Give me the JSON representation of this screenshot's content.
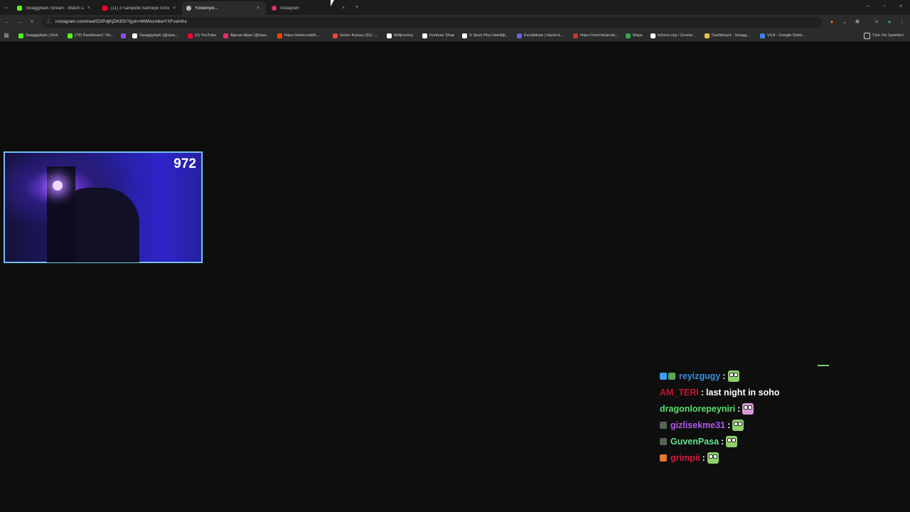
{
  "tabs": [
    {
      "title": "Swaggybark Stream - Watch Li",
      "color": "#53fc18",
      "active": false
    },
    {
      "title": "(11) 3 Saniyede Sahneye Göre",
      "color": "#ff0033",
      "active": false
    },
    {
      "title": "Yükleniyor...",
      "color": "#bbbbbb",
      "active": true
    },
    {
      "title": "Instagram",
      "color": "#e1306c",
      "active": false
    }
  ],
  "new_tab_label": "+",
  "close_label": "×",
  "address_bar": {
    "url": "instagram.com/reel/DXPdjKjDK8S/?igsh=MWtocmkwYXFvaHAx"
  },
  "bookmarks": [
    {
      "label": "Swaggybark | Kick",
      "color": "#53fc18"
    },
    {
      "label": "(79) Dashboard / Str...",
      "color": "#53fc18"
    },
    {
      "label": "",
      "color": "#9146ff"
    },
    {
      "label": "Swaggybark (@swa...",
      "color": "#ffffff"
    },
    {
      "label": "(2) YouTube",
      "color": "#ff0033"
    },
    {
      "label": "Alpcan Alpar (@swa...",
      "color": "#e1306c"
    },
    {
      "label": "https://www.reddit....",
      "color": "#ff4500"
    },
    {
      "label": "Gelen Kutusu (31) -...",
      "color": "#ea4335"
    },
    {
      "label": "Midjourney",
      "color": "#ffffff"
    },
    {
      "label": "Konfuse Shop",
      "color": "#ffffff"
    },
    {
      "label": "S Sport Plus-İstediği...",
      "color": "#ffffff"
    },
    {
      "label": "Excalidraw | Hand-d...",
      "color": "#6965db"
    },
    {
      "label": "https://next.inkarnat...",
      "color": "#cc3333"
    },
    {
      "label": "Maps",
      "color": "#34a853"
    },
    {
      "label": "lichess.org • Ücretsi...",
      "color": "#ffffff"
    },
    {
      "label": "Dashboard - Swagg...",
      "color": "#e8c34a"
    },
    {
      "label": "V0.8 - Google Dokü...",
      "color": "#4285f4"
    }
  ],
  "all_bookmarks_label": "Tüm Yer İşaretleri",
  "overlay": {
    "viewer_count": "972",
    "chat": [
      {
        "user": "reyizgugy",
        "color": "#3a8fe0",
        "msg": "",
        "emote": "frog"
      },
      {
        "user": "AM_TERI",
        "color": "#c8102e",
        "msg": "last night in soho",
        "emote": ""
      },
      {
        "user": "dragonlorepeyniri",
        "color": "#56e06b",
        "msg": "",
        "emote": "pink"
      },
      {
        "user": "gizlisekme31",
        "color": "#b05be8",
        "msg": "",
        "emote": "frog"
      },
      {
        "user": "GuvenPasa",
        "color": "#66e08e",
        "msg": "",
        "emote": "frog"
      },
      {
        "user": "grimpii",
        "color": "#d01c3a",
        "msg": "",
        "emote": "frog"
      }
    ]
  }
}
